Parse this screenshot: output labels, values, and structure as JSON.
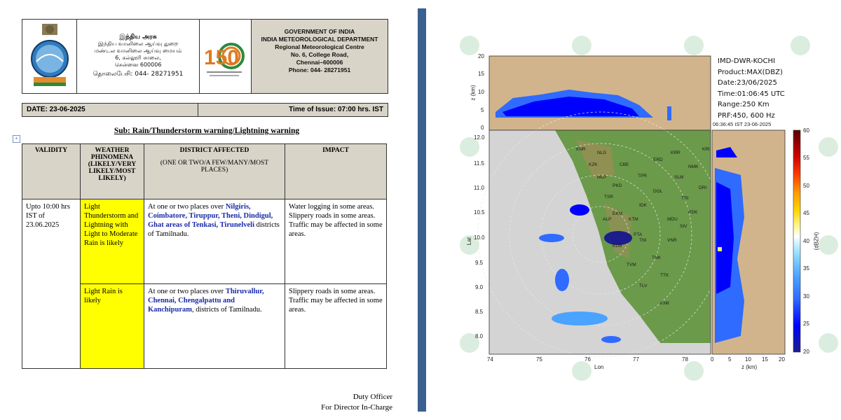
{
  "header": {
    "tamil_lines": [
      "இந்திய அரசு",
      "இந்திய வானிலை ஆய்வு துறை",
      "மண்டல வானிலை ஆய்வு மையம்",
      "6, கல்லூரி சாலை,",
      "சென்னை 600006"
    ],
    "tamil_phone": "தொலைபேசி:  044- 28271951",
    "logo_150_text": "150",
    "gov_lines": [
      "GOVERNMENT OF INDIA",
      "INDIA METEOROLOGICAL DEPARTMENT",
      "Regional Meteorological Centre",
      "No. 6, College Road,",
      "Chennai–600006",
      "Phone:  044- 28271951"
    ]
  },
  "date_bar": {
    "date": "DATE: 23-06-2025",
    "issue_time": "Time of Issue: 07:00 hrs. IST"
  },
  "subject": "Sub: Rain/Thunderstorm warning/Lightning warning",
  "table": {
    "headers": {
      "validity": "VALIDITY",
      "phenomena": "WEATHER PHINOMENA (LIKELY/VERY LIKELY/MOST LIKELY)",
      "district_title": "DISTRICT AFFECTED",
      "district_sub": "(ONE OR TWO/A FEW/MANY/MOST PLACES)",
      "impact": "IMPACT"
    },
    "validity": "Upto 10:00 hrs IST of 23.06.2025",
    "rows": [
      {
        "phenomena": "Light Thunderstorm and Lightning with Light to Moderate Rain is likely",
        "district_prefix": "At one or two places over ",
        "district_names": "Nilgiris, Coimbatore, Tiruppur, Theni, Dindigul, Ghat areas of Tenkasi, Tirunelveli",
        "district_suffix": " districts of Tamilnadu.",
        "impacts": [
          "Water logging in some areas.",
          "Slippery roads in some areas.",
          "Traffic may be affected in some areas."
        ]
      },
      {
        "phenomena": "Light  Rain is likely",
        "district_prefix": "At one or two places over ",
        "district_names": "Thiruvallur, Chennai, Chengalpattu and  Kanchipuram",
        "district_suffix": ", districts of Tamilnadu.",
        "impacts": [
          "Slippery roads in some areas.",
          "Traffic may be affected in some areas."
        ]
      }
    ]
  },
  "signature": [
    "Duty Officer",
    "For Director In-Charge"
  ],
  "radar": {
    "info_lines": [
      "IMD-DWR-KOCHI",
      "Product:MAX(DBZ)",
      "Date:23/06/2025",
      "Time:01:06:45 UTC",
      "Range:250 Km",
      "PRF:450, 600 Hz"
    ],
    "timestamp": "06:36:45 IST 23-06-2025",
    "top_panel": {
      "ylabel": "z (km)",
      "yticks": [
        "20",
        "15",
        "10",
        "5",
        "0"
      ]
    },
    "main_panel": {
      "ylabel": "Lat",
      "xlabel": "Lon",
      "yticks": [
        "12.0",
        "11.5",
        "11.0",
        "10.5",
        "10.0",
        "9.5",
        "9.0",
        "8.5",
        "8.0"
      ],
      "xticks": [
        "74",
        "75",
        "76",
        "77",
        "78"
      ]
    },
    "side_panel": {
      "xlabel": "z (km)",
      "xticks": [
        "0",
        "5",
        "10",
        "15",
        "20"
      ]
    },
    "colorbar": {
      "label": "(dBZH)",
      "ticks": [
        "60",
        "55",
        "50",
        "45",
        "40",
        "35",
        "30",
        "25",
        "20"
      ],
      "colors": [
        "#1c1c8c",
        "#0000ff",
        "#2f6bff",
        "#4aa3ff",
        "#7fd0ff",
        "#bfefff",
        "#ffffff",
        "#fff27a",
        "#ffd400",
        "#ff9a00",
        "#ff3c00",
        "#d40000",
        "#8c0000",
        "#5a0000"
      ]
    },
    "city_labels": [
      "KNR",
      "KZK",
      "MLP",
      "PKD",
      "TSR",
      "EKM",
      "KTM",
      "IDK",
      "ALP",
      "PTA",
      "KLM",
      "TVM",
      "NLG",
      "CBE",
      "TPR",
      "DGL",
      "MDU",
      "TNI",
      "TNK",
      "TLV",
      "TTK",
      "KNK",
      "VNR",
      "SIV",
      "PDK",
      "TRI",
      "SLM",
      "ERD",
      "KRR",
      "NMK",
      "DRI",
      "KRI"
    ]
  }
}
